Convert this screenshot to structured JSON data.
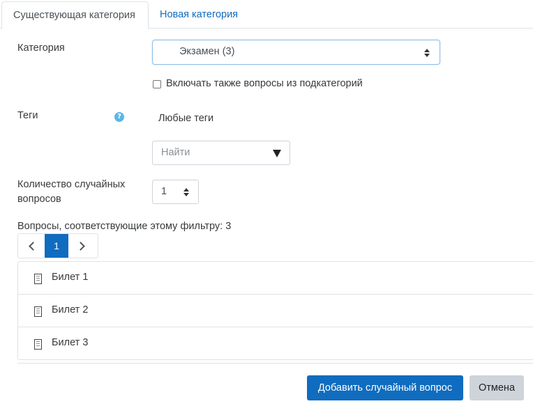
{
  "tabs": [
    {
      "label": "Существующая категория",
      "active": true
    },
    {
      "label": "Новая категория",
      "active": false
    }
  ],
  "form": {
    "category_label": "Категория",
    "category_value": "Экзамен (3)",
    "include_subcategories_label": "Включать также вопросы из подкатегорий",
    "include_subcategories_checked": false,
    "tags_label": "Теги",
    "tags_value": "Любые теги",
    "tags_search_placeholder": "Найти",
    "count_label_line1": "Количество случайных",
    "count_label_line2": "вопросов",
    "count_value": "1"
  },
  "questions": {
    "summary": "Вопросы, соответствующие этому фильтру: 3",
    "current_page": "1",
    "items": [
      {
        "name": "Билет 1"
      },
      {
        "name": "Билет 2"
      },
      {
        "name": "Билет 3"
      }
    ]
  },
  "actions": {
    "add_label": "Добавить случайный вопрос",
    "cancel_label": "Отмена"
  },
  "colors": {
    "primary": "#0f6cbf",
    "help": "#5bb7e6",
    "secondary_button": "#ced4da"
  }
}
